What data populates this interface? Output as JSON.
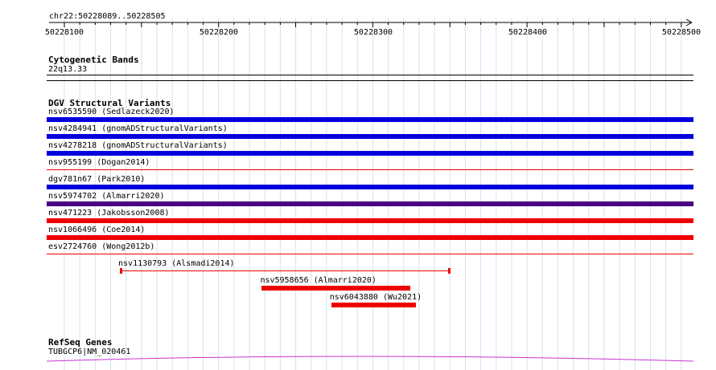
{
  "ruler": {
    "region_label": "chr22:50228089..50228505",
    "ticks": [
      "50228100",
      "50228200",
      "50228300",
      "50228400",
      "50228500"
    ]
  },
  "cytoband": {
    "title": "Cytogenetic Bands",
    "band": "22q13.33"
  },
  "dgv": {
    "title": "DGV Structural Variants",
    "colors": {
      "gain": "#0000dd",
      "loss": "#ee0000",
      "gain_loss": "#4b0082"
    },
    "full_variants": [
      {
        "label": "nsv6535590 (Sedlazeck2020)",
        "type": "gain",
        "style": "bar"
      },
      {
        "label": "nsv4284941 (gnomADStructuralVariants)",
        "type": "gain",
        "style": "bar"
      },
      {
        "label": "nsv4278218 (gnomADStructuralVariants)",
        "type": "gain",
        "style": "bar"
      },
      {
        "label": "nsv955199 (Dogan2014)",
        "type": "loss",
        "style": "line"
      },
      {
        "label": "dgv781n67 (Park2010)",
        "type": "gain",
        "style": "bar"
      },
      {
        "label": "nsv5974702 (Almarri2020)",
        "type": "gain_loss",
        "style": "bar"
      },
      {
        "label": "nsv471223 (Jakobsson2008)",
        "type": "loss",
        "style": "bar"
      },
      {
        "label": "nsv1066496 (Coe2014)",
        "type": "loss",
        "style": "bar"
      },
      {
        "label": "esv2724760 (Wong2012b)",
        "type": "loss",
        "style": "line"
      }
    ],
    "partial_variants": [
      {
        "label": "nsv1130793 (Alsmadi2014)",
        "start": 50228136,
        "end": 50228350,
        "style": "whisker"
      },
      {
        "label": "nsv5958656 (Almarri2020)",
        "start": 50228228,
        "end": 50228324,
        "style": "bar"
      },
      {
        "label": "nsv6043880 (Wu2021)",
        "start": 50228273,
        "end": 50228328,
        "style": "bar"
      }
    ]
  },
  "refseq": {
    "title": "RefSeq Genes",
    "gene": "TUBGCP6|NM_020461"
  }
}
